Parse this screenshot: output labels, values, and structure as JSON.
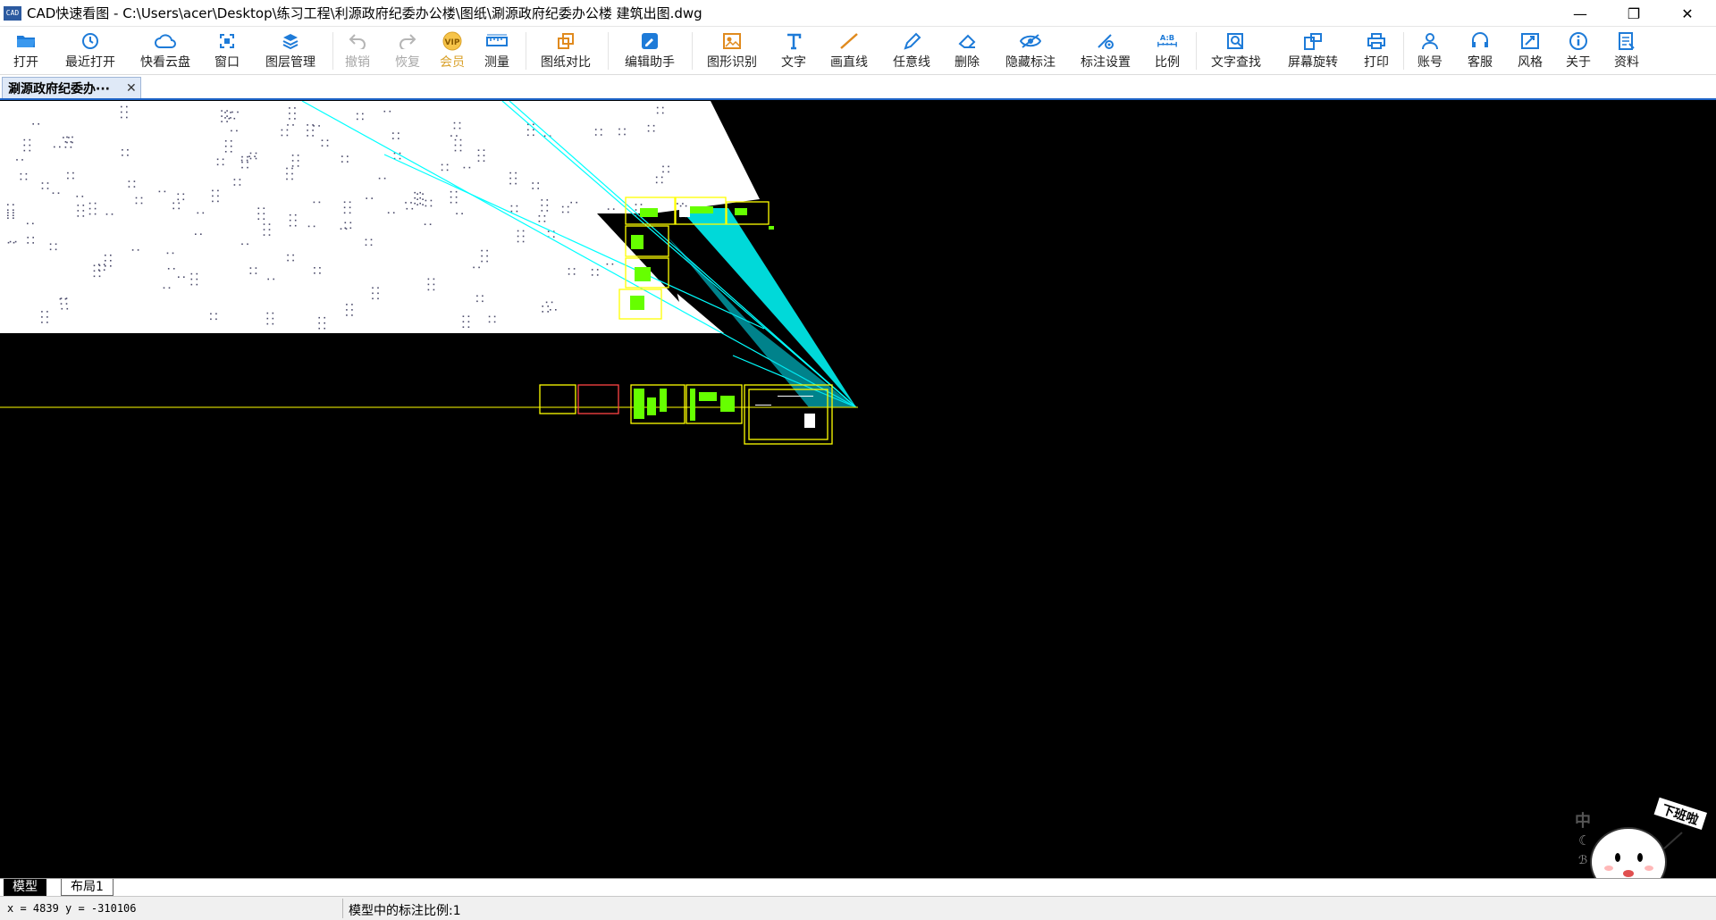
{
  "window": {
    "title": "CAD快速看图 - C:\\Users\\acer\\Desktop\\练习工程\\利源政府纪委办公楼\\图纸\\涮源政府纪委办公楼 建筑出图.dwg",
    "app_icon_text": "CAD",
    "minimize": "—",
    "maximize": "❐",
    "close": "✕"
  },
  "toolbar": {
    "items": [
      {
        "id": "open",
        "label": "打开",
        "icon": "folder-icon"
      },
      {
        "id": "recent",
        "label": "最近打开",
        "icon": "clock-icon"
      },
      {
        "id": "cloud",
        "label": "快看云盘",
        "icon": "cloud-icon"
      },
      {
        "id": "window",
        "label": "窗口",
        "icon": "window-icon"
      },
      {
        "id": "layers",
        "label": "图层管理",
        "icon": "layers-icon"
      },
      {
        "id": "undo",
        "label": "撤销",
        "icon": "undo-icon"
      },
      {
        "id": "redo",
        "label": "恢复",
        "icon": "redo-icon"
      },
      {
        "id": "vip",
        "label": "会员",
        "icon": "vip-icon"
      },
      {
        "id": "measure",
        "label": "测量",
        "icon": "ruler-icon"
      },
      {
        "id": "compare",
        "label": "图纸对比",
        "icon": "compare-icon"
      },
      {
        "id": "edit",
        "label": "编辑助手",
        "icon": "edit-icon"
      },
      {
        "id": "recognize",
        "label": "图形识别",
        "icon": "recognize-icon"
      },
      {
        "id": "text",
        "label": "文字",
        "icon": "text-icon"
      },
      {
        "id": "line",
        "label": "画直线",
        "icon": "line-icon"
      },
      {
        "id": "freeline",
        "label": "任意线",
        "icon": "pen-icon"
      },
      {
        "id": "delete",
        "label": "删除",
        "icon": "eraser-icon"
      },
      {
        "id": "hide",
        "label": "隐藏标注",
        "icon": "eye-icon"
      },
      {
        "id": "dimset",
        "label": "标注设置",
        "icon": "dim-settings-icon"
      },
      {
        "id": "scale",
        "label": "比例",
        "icon": "scale-icon"
      },
      {
        "id": "find",
        "label": "文字查找",
        "icon": "find-text-icon"
      },
      {
        "id": "rotate",
        "label": "屏幕旋转",
        "icon": "rotate-icon"
      },
      {
        "id": "print",
        "label": "打印",
        "icon": "printer-icon"
      },
      {
        "id": "account",
        "label": "账号",
        "icon": "user-icon"
      },
      {
        "id": "service",
        "label": "客服",
        "icon": "headset-icon"
      },
      {
        "id": "style",
        "label": "风格",
        "icon": "style-icon"
      },
      {
        "id": "about",
        "label": "关于",
        "icon": "info-icon"
      },
      {
        "id": "data",
        "label": "资料",
        "icon": "document-icon"
      }
    ],
    "vip_badge": "VIP",
    "scale_badge": "A:B"
  },
  "tabs": {
    "document_tab": "涮源政府纪委办···",
    "close_glyph": "✕"
  },
  "layout_tabs": {
    "model": "模型",
    "layout1": "布局1"
  },
  "status": {
    "coordinates": "x = 4839  y = -310106",
    "annotation_scale": "模型中的标注比例:1"
  },
  "ime": {
    "mode": "中",
    "moon": "☾",
    "misc": "ℬ"
  },
  "mascot": {
    "sign_text": "下班啦"
  },
  "colors": {
    "canvas_bg": "#000000",
    "accent_blue": "#1e64c8",
    "cyan": "#00ffff",
    "yellow": "#ffff00",
    "green": "#66ff00",
    "vip_gold": "#d9a12a"
  }
}
